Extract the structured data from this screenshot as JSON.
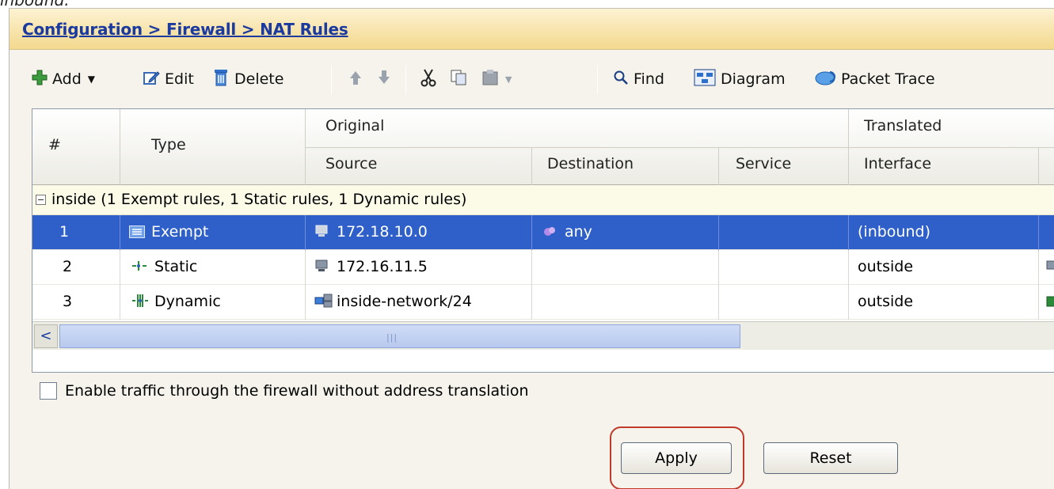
{
  "page_top_text": "inbound.",
  "breadcrumb": "Configuration > Firewall > NAT Rules",
  "toolbar": {
    "add": "Add",
    "edit": "Edit",
    "delete": "Delete",
    "find": "Find",
    "diagram": "Diagram",
    "packet_trace": "Packet Trace"
  },
  "table": {
    "headers": {
      "num": "#",
      "type": "Type",
      "original": "Original",
      "translated": "Translated",
      "source": "Source",
      "destination": "Destination",
      "service": "Service",
      "interface": "Interface"
    },
    "group_label": "inside (1 Exempt rules, 1 Static rules, 1 Dynamic rules)",
    "rows": [
      {
        "num": "1",
        "type": "Exempt",
        "source": "172.18.10.0",
        "destination": "any",
        "service": "",
        "interface": "(inbound)",
        "selected": true
      },
      {
        "num": "2",
        "type": "Static",
        "source": "172.16.11.5",
        "destination": "",
        "service": "",
        "interface": "outside",
        "selected": false
      },
      {
        "num": "3",
        "type": "Dynamic",
        "source": "inside-network/24",
        "destination": "",
        "service": "",
        "interface": "outside",
        "selected": false
      }
    ]
  },
  "checkbox_label": "Enable traffic through the firewall without address translation",
  "buttons": {
    "apply": "Apply",
    "reset": "Reset"
  },
  "colors": {
    "selection": "#2f5fc9",
    "breadcrumb_link": "#1a3aa0",
    "highlight_ring": "#c0392b"
  }
}
